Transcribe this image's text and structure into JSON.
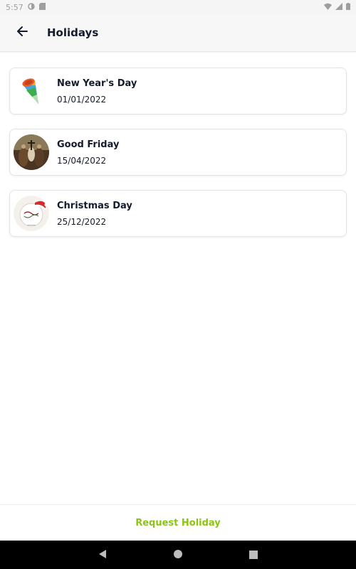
{
  "status_bar": {
    "time": "5:57"
  },
  "app_bar": {
    "title": "Holidays"
  },
  "holidays": [
    {
      "name": "New Year's Day",
      "date": "01/01/2022",
      "icon": "party-popper-icon"
    },
    {
      "name": "Good Friday",
      "date": "15/04/2022",
      "icon": "painting-thumbnail"
    },
    {
      "name": "Christmas Day",
      "date": "25/12/2022",
      "icon": "christmas-card-thumbnail"
    }
  ],
  "actions": {
    "request_label": "Request Holiday"
  },
  "colors": {
    "accent": "#8cc414",
    "title_text": "#141b2d",
    "app_bar_bg": "#f7f7f7"
  }
}
